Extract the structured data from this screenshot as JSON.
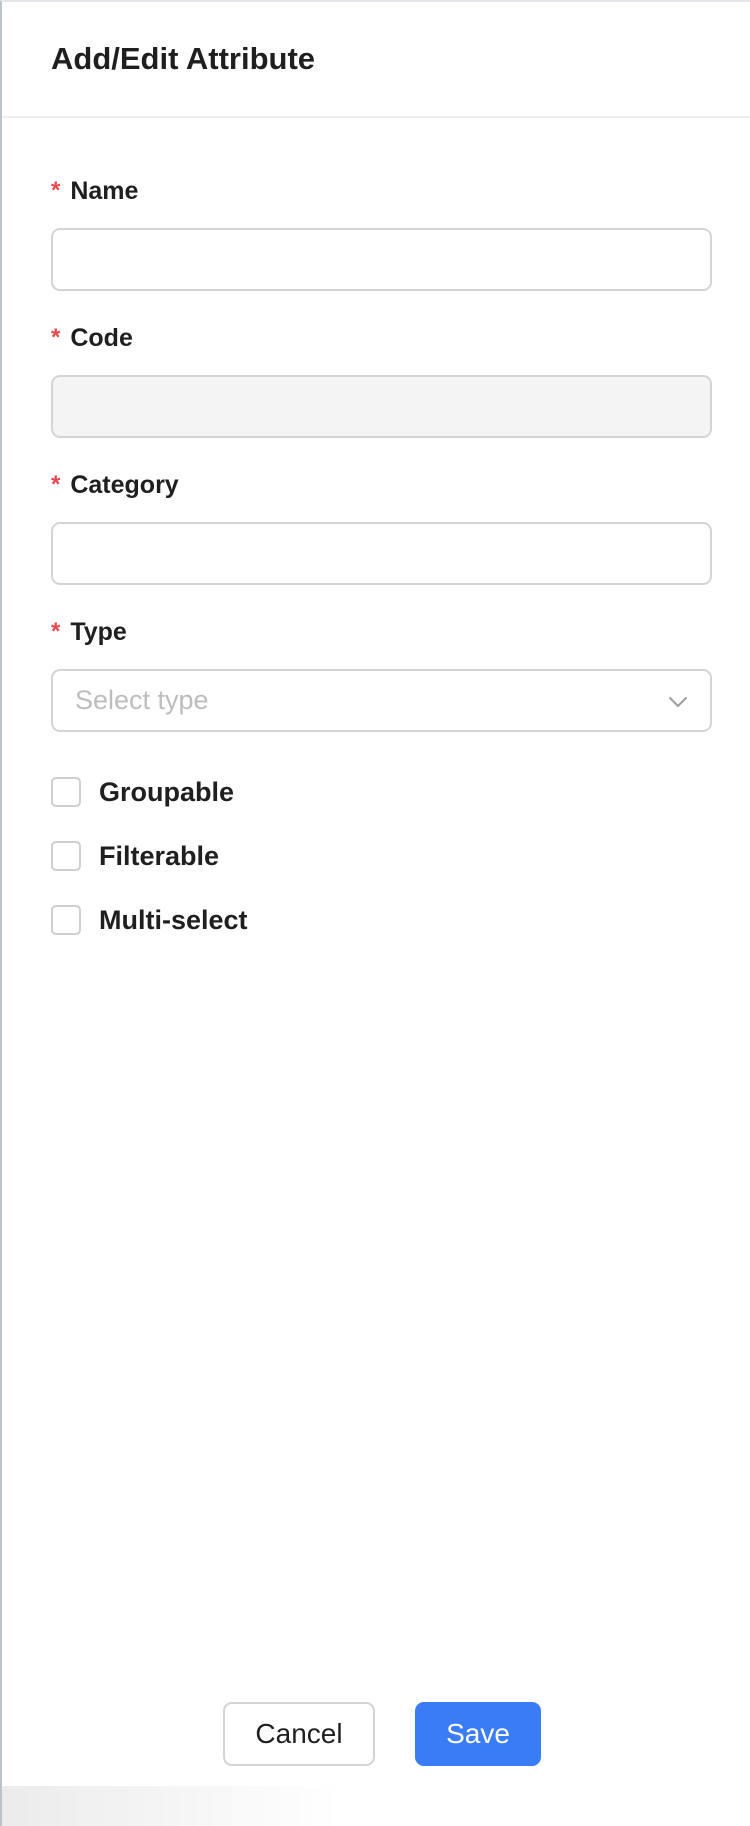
{
  "drawer": {
    "title": "Add/Edit Attribute"
  },
  "form": {
    "fields": [
      {
        "label": "Name",
        "required_mark": "*",
        "value": "",
        "placeholder": ""
      },
      {
        "label": "Code",
        "required_mark": "*",
        "value": "",
        "placeholder": "",
        "disabled": true
      },
      {
        "label": "Category",
        "required_mark": "*",
        "value": "",
        "placeholder": ""
      }
    ],
    "type": {
      "label": "Type",
      "required_mark": "*",
      "placeholder": "Select type",
      "icon": "chevron-down-icon"
    },
    "checkboxes": [
      {
        "label": "Groupable",
        "checked": false
      },
      {
        "label": "Filterable",
        "checked": false
      },
      {
        "label": "Multi-select",
        "checked": false
      }
    ]
  },
  "footer": {
    "cancel_label": "Cancel",
    "save_label": "Save"
  },
  "colors": {
    "primary": "#3a7bf6",
    "required": "#e5484d",
    "border": "#d4d4d4",
    "disabled_bg": "#f4f4f4"
  }
}
